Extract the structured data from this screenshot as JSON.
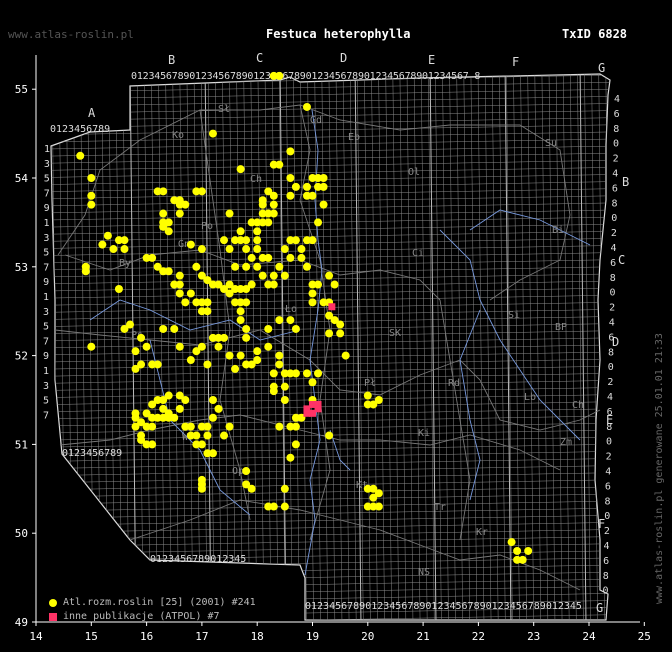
{
  "header": {
    "site": "www.atlas-roslin.pl",
    "title": "Festuca heterophylla",
    "taxid": "TxID 6828"
  },
  "footer": {
    "generated": "www.atlas-roslin.pl generowane 25.01.01 21:33"
  },
  "axes": {
    "x_ticks": [
      "14",
      "15",
      "16",
      "17",
      "18",
      "19",
      "20",
      "21",
      "22",
      "23",
      "24",
      "25"
    ],
    "y_ticks": [
      "49",
      "50",
      "51",
      "52",
      "53",
      "54",
      "55"
    ]
  },
  "atpol": {
    "col_letters": [
      "A",
      "B",
      "C",
      "D",
      "E",
      "F",
      "G"
    ],
    "row_letters": [
      "A",
      "B",
      "C",
      "D",
      "E",
      "F",
      "G"
    ],
    "top_digits": "0123456789012345678901234567890123456789012345678901234567 8",
    "bottom_digits": "0123456789012345678901234567890123456789012345"
  },
  "regions": [
    "Ko",
    "Sł",
    "Gd",
    "Eb",
    "Su",
    "Ol",
    "Ch",
    "Bi",
    "Ci",
    "By",
    "Ło",
    "Si",
    "BP",
    "SK",
    "Pł",
    "Rd",
    "Ki",
    "Lb",
    "Kt",
    "Tr",
    "Ch",
    "Zm",
    "NS",
    "Kr",
    "Op",
    "Wr",
    "Po",
    "Ps",
    "Gn"
  ],
  "legend": [
    {
      "label": "Atl.rozm.roslin [25] (2001) #241",
      "color": "#ffff00",
      "marker": "circle"
    },
    {
      "label": "inne publikacje (ATPOL) #7",
      "color": "#ff3366",
      "marker": "square"
    }
  ],
  "points_atlas": [
    [
      14.8,
      54.25
    ],
    [
      15.0,
      54.0
    ],
    [
      15.0,
      53.8
    ],
    [
      15.0,
      53.7
    ],
    [
      14.9,
      53.0
    ],
    [
      14.9,
      52.95
    ],
    [
      15.2,
      53.25
    ],
    [
      15.3,
      53.35
    ],
    [
      15.4,
      53.2
    ],
    [
      15.5,
      53.3
    ],
    [
      15.6,
      53.3
    ],
    [
      15.6,
      53.2
    ],
    [
      15.5,
      52.75
    ],
    [
      15.6,
      52.3
    ],
    [
      15.7,
      52.35
    ],
    [
      15.0,
      52.1
    ],
    [
      16.0,
      53.1
    ],
    [
      16.1,
      53.1
    ],
    [
      16.2,
      53.85
    ],
    [
      16.3,
      53.85
    ],
    [
      16.3,
      53.6
    ],
    [
      16.3,
      53.5
    ],
    [
      16.3,
      53.45
    ],
    [
      16.4,
      53.5
    ],
    [
      16.4,
      53.4
    ],
    [
      16.2,
      53.0
    ],
    [
      16.3,
      52.95
    ],
    [
      16.4,
      52.95
    ],
    [
      16.5,
      52.8
    ],
    [
      16.6,
      52.8
    ],
    [
      16.6,
      52.9
    ],
    [
      16.6,
      52.7
    ],
    [
      16.7,
      52.6
    ],
    [
      16.5,
      53.75
    ],
    [
      16.6,
      53.75
    ],
    [
      16.7,
      53.7
    ],
    [
      16.6,
      53.7
    ],
    [
      16.6,
      53.6
    ],
    [
      16.9,
      53.85
    ],
    [
      17.0,
      53.85
    ],
    [
      16.8,
      53.25
    ],
    [
      17.0,
      53.2
    ],
    [
      16.9,
      53.0
    ],
    [
      17.0,
      52.9
    ],
    [
      17.1,
      52.85
    ],
    [
      17.2,
      52.8
    ],
    [
      16.8,
      52.7
    ],
    [
      16.9,
      52.6
    ],
    [
      17.0,
      52.6
    ],
    [
      17.0,
      52.5
    ],
    [
      17.1,
      52.5
    ],
    [
      17.1,
      52.6
    ],
    [
      17.3,
      52.8
    ],
    [
      17.4,
      52.75
    ],
    [
      17.5,
      52.8
    ],
    [
      17.5,
      52.7
    ],
    [
      17.6,
      52.75
    ],
    [
      17.6,
      52.6
    ],
    [
      17.7,
      52.75
    ],
    [
      17.7,
      52.6
    ],
    [
      17.8,
      52.75
    ],
    [
      17.9,
      52.8
    ],
    [
      17.8,
      52.6
    ],
    [
      17.7,
      52.5
    ],
    [
      17.7,
      52.4
    ],
    [
      17.2,
      54.5
    ],
    [
      17.7,
      54.1
    ],
    [
      17.5,
      53.6
    ],
    [
      17.4,
      53.3
    ],
    [
      17.5,
      53.2
    ],
    [
      17.6,
      53.3
    ],
    [
      17.7,
      53.3
    ],
    [
      17.8,
      53.2
    ],
    [
      17.8,
      53.3
    ],
    [
      17.9,
      53.5
    ],
    [
      17.7,
      53.4
    ],
    [
      17.6,
      53.0
    ],
    [
      17.8,
      53.0
    ],
    [
      17.9,
      53.1
    ],
    [
      18.0,
      53.2
    ],
    [
      18.0,
      53.3
    ],
    [
      18.0,
      53.4
    ],
    [
      18.0,
      53.5
    ],
    [
      18.1,
      53.6
    ],
    [
      18.1,
      53.7
    ],
    [
      18.1,
      53.75
    ],
    [
      18.2,
      53.6
    ],
    [
      18.3,
      53.6
    ],
    [
      18.3,
      53.7
    ],
    [
      18.3,
      53.8
    ],
    [
      18.2,
      53.85
    ],
    [
      18.2,
      53.5
    ],
    [
      18.1,
      53.5
    ],
    [
      18.0,
      53.0
    ],
    [
      18.1,
      53.1
    ],
    [
      18.2,
      53.1
    ],
    [
      18.1,
      52.9
    ],
    [
      18.2,
      52.8
    ],
    [
      18.3,
      52.8
    ],
    [
      18.3,
      52.9
    ],
    [
      18.5,
      52.9
    ],
    [
      18.4,
      53.0
    ],
    [
      18.5,
      53.2
    ],
    [
      18.6,
      53.3
    ],
    [
      18.7,
      53.3
    ],
    [
      18.8,
      53.2
    ],
    [
      18.8,
      53.1
    ],
    [
      18.6,
      53.1
    ],
    [
      18.9,
      53.3
    ],
    [
      18.9,
      53.0
    ],
    [
      18.3,
      54.15
    ],
    [
      18.4,
      54.15
    ],
    [
      18.6,
      54.3
    ],
    [
      18.6,
      54.0
    ],
    [
      18.7,
      53.9
    ],
    [
      18.6,
      53.8
    ],
    [
      18.9,
      53.9
    ],
    [
      18.9,
      53.8
    ],
    [
      19.0,
      54.0
    ],
    [
      19.0,
      53.8
    ],
    [
      19.1,
      54.0
    ],
    [
      19.2,
      54.0
    ],
    [
      19.1,
      53.9
    ],
    [
      19.2,
      53.9
    ],
    [
      19.2,
      53.7
    ],
    [
      19.1,
      53.5
    ],
    [
      19.0,
      53.3
    ],
    [
      18.3,
      55.15
    ],
    [
      18.4,
      55.15
    ],
    [
      18.9,
      54.8
    ],
    [
      16.3,
      52.3
    ],
    [
      16.0,
      52.1
    ],
    [
      15.9,
      52.2
    ],
    [
      15.8,
      52.05
    ],
    [
      15.9,
      51.9
    ],
    [
      15.8,
      51.85
    ],
    [
      16.2,
      51.9
    ],
    [
      16.1,
      51.9
    ],
    [
      16.5,
      52.3
    ],
    [
      16.6,
      52.1
    ],
    [
      16.9,
      52.05
    ],
    [
      16.8,
      51.95
    ],
    [
      17.0,
      52.1
    ],
    [
      17.2,
      52.2
    ],
    [
      17.3,
      52.2
    ],
    [
      17.4,
      52.2
    ],
    [
      17.3,
      52.1
    ],
    [
      17.1,
      51.9
    ],
    [
      17.5,
      52.0
    ],
    [
      17.6,
      51.85
    ],
    [
      17.8,
      52.2
    ],
    [
      17.8,
      52.3
    ],
    [
      17.7,
      52.0
    ],
    [
      17.8,
      51.9
    ],
    [
      17.9,
      51.9
    ],
    [
      18.0,
      52.05
    ],
    [
      18.0,
      51.95
    ],
    [
      18.2,
      52.3
    ],
    [
      18.2,
      52.1
    ],
    [
      18.4,
      52.4
    ],
    [
      18.6,
      52.4
    ],
    [
      18.7,
      52.3
    ],
    [
      18.4,
      52.0
    ],
    [
      18.4,
      51.9
    ],
    [
      18.3,
      51.8
    ],
    [
      18.5,
      51.8
    ],
    [
      18.6,
      51.8
    ],
    [
      18.7,
      51.8
    ],
    [
      15.8,
      51.35
    ],
    [
      15.8,
      51.3
    ],
    [
      15.9,
      51.25
    ],
    [
      15.8,
      51.2
    ],
    [
      15.9,
      51.1
    ],
    [
      15.9,
      51.05
    ],
    [
      16.0,
      51.0
    ],
    [
      16.1,
      51.0
    ],
    [
      16.0,
      51.2
    ],
    [
      16.1,
      51.2
    ],
    [
      16.1,
      51.3
    ],
    [
      16.2,
      51.3
    ],
    [
      16.3,
      51.3
    ],
    [
      16.3,
      51.4
    ],
    [
      16.4,
      51.35
    ],
    [
      16.4,
      51.3
    ],
    [
      16.5,
      51.3
    ],
    [
      16.6,
      51.4
    ],
    [
      16.3,
      51.5
    ],
    [
      16.2,
      51.5
    ],
    [
      16.4,
      51.55
    ],
    [
      16.0,
      51.35
    ],
    [
      16.1,
      51.45
    ],
    [
      16.6,
      51.55
    ],
    [
      16.7,
      51.5
    ],
    [
      16.7,
      51.2
    ],
    [
      16.8,
      51.1
    ],
    [
      16.9,
      51.1
    ],
    [
      16.9,
      51.0
    ],
    [
      17.0,
      51.0
    ],
    [
      17.0,
      51.2
    ],
    [
      17.1,
      51.2
    ],
    [
      17.1,
      51.1
    ],
    [
      17.2,
      51.3
    ],
    [
      17.3,
      51.4
    ],
    [
      17.2,
      51.5
    ],
    [
      17.2,
      50.9
    ],
    [
      17.1,
      50.9
    ],
    [
      16.8,
      51.2
    ],
    [
      17.4,
      51.1
    ],
    [
      17.5,
      51.2
    ],
    [
      17.0,
      50.6
    ],
    [
      17.0,
      50.5
    ],
    [
      17.0,
      50.55
    ],
    [
      17.8,
      50.7
    ],
    [
      17.8,
      50.55
    ],
    [
      17.9,
      50.5
    ],
    [
      18.2,
      50.3
    ],
    [
      18.3,
      50.3
    ],
    [
      18.5,
      50.3
    ],
    [
      18.5,
      50.5
    ],
    [
      18.6,
      50.85
    ],
    [
      18.7,
      51.0
    ],
    [
      18.7,
      51.2
    ],
    [
      18.6,
      51.2
    ],
    [
      18.4,
      51.2
    ],
    [
      18.5,
      51.5
    ],
    [
      18.3,
      51.6
    ],
    [
      18.3,
      51.65
    ],
    [
      18.5,
      51.65
    ],
    [
      18.7,
      51.3
    ],
    [
      18.8,
      51.3
    ],
    [
      19.0,
      51.5
    ],
    [
      19.0,
      51.7
    ],
    [
      18.9,
      51.8
    ],
    [
      19.1,
      51.8
    ],
    [
      19.3,
      52.25
    ],
    [
      19.3,
      52.45
    ],
    [
      19.4,
      52.4
    ],
    [
      19.5,
      52.25
    ],
    [
      19.5,
      52.35
    ],
    [
      19.6,
      52.0
    ],
    [
      20.0,
      51.55
    ],
    [
      20.0,
      51.45
    ],
    [
      20.1,
      51.45
    ],
    [
      20.2,
      51.5
    ],
    [
      20.0,
      50.5
    ],
    [
      20.1,
      50.5
    ],
    [
      20.0,
      50.3
    ],
    [
      20.1,
      50.3
    ],
    [
      20.2,
      50.3
    ],
    [
      20.1,
      50.4
    ],
    [
      20.2,
      50.45
    ],
    [
      19.3,
      51.1
    ],
    [
      19.0,
      52.6
    ],
    [
      19.2,
      52.6
    ],
    [
      19.3,
      52.6
    ],
    [
      19.0,
      52.8
    ],
    [
      19.1,
      52.8
    ],
    [
      19.0,
      52.7
    ],
    [
      19.4,
      52.8
    ],
    [
      19.3,
      52.9
    ],
    [
      22.6,
      49.9
    ],
    [
      22.7,
      49.8
    ],
    [
      22.7,
      49.7
    ],
    [
      22.8,
      49.7
    ],
    [
      22.9,
      49.8
    ]
  ],
  "points_other": [
    [
      19.35,
      52.55
    ],
    [
      19.0,
      51.45
    ],
    [
      19.1,
      51.45
    ],
    [
      19.0,
      51.35
    ],
    [
      18.9,
      51.35
    ],
    [
      18.9,
      51.4
    ],
    [
      19.1,
      51.4
    ]
  ]
}
